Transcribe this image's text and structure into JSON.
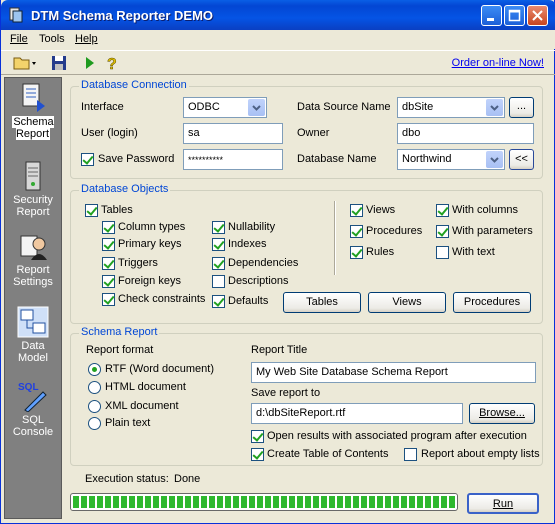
{
  "window": {
    "title": "DTM Schema Reporter DEMO"
  },
  "menu": [
    "File",
    "Tools",
    "Help"
  ],
  "toolbar": {
    "order_link": "Order on-line Now!"
  },
  "sidebar": [
    {
      "label": "Schema Report",
      "icon": "schema-report-icon"
    },
    {
      "label": "Security Report",
      "icon": "server-icon"
    },
    {
      "label": "Report Settings",
      "icon": "settings-icon"
    },
    {
      "label": "Data Model",
      "icon": "data-model-icon"
    },
    {
      "label": "SQL Console",
      "icon": "sql-console-icon"
    }
  ],
  "connection": {
    "title": "Database Connection",
    "interface_label": "Interface",
    "interface_value": "ODBC",
    "user_label": "User (login)",
    "user_value": "sa",
    "save_password_label": "Save Password",
    "save_password_checked": true,
    "password_value": "**********",
    "dsn_label": "Data Source Name",
    "dsn_value": "dbSite",
    "dsn_browse": "...",
    "owner_label": "Owner",
    "owner_value": "dbo",
    "dbname_label": "Database Name",
    "dbname_value": "Northwind",
    "dbname_button": "<<"
  },
  "objects": {
    "title": "Database Objects",
    "tables": {
      "label": "Tables",
      "checked": true
    },
    "col1": [
      {
        "label": "Column types",
        "checked": true
      },
      {
        "label": "Primary keys",
        "checked": true
      },
      {
        "label": "Triggers",
        "checked": true
      },
      {
        "label": "Foreign keys",
        "checked": true
      },
      {
        "label": "Check constraints",
        "checked": true
      }
    ],
    "col2": [
      {
        "label": "Nullability",
        "checked": true
      },
      {
        "label": "Indexes",
        "checked": true
      },
      {
        "label": "Dependencies",
        "checked": true
      },
      {
        "label": "Descriptions",
        "checked": false
      },
      {
        "label": "Defaults",
        "checked": true
      }
    ],
    "col3": [
      {
        "label": "Views",
        "checked": true
      },
      {
        "label": "Procedures",
        "checked": true
      },
      {
        "label": "Rules",
        "checked": true
      }
    ],
    "col4": [
      {
        "label": "With columns",
        "checked": true
      },
      {
        "label": "With parameters",
        "checked": true
      },
      {
        "label": "With text",
        "checked": false
      }
    ],
    "buttons": {
      "tables": "Tables",
      "views": "Views",
      "procedures": "Procedures"
    }
  },
  "schema_report": {
    "title": "Schema Report",
    "format_label": "Report format",
    "formats": [
      {
        "label": "RTF (Word document)",
        "selected": true
      },
      {
        "label": "HTML document",
        "selected": false
      },
      {
        "label": "XML document",
        "selected": false
      },
      {
        "label": "Plain text",
        "selected": false
      }
    ],
    "report_title_label": "Report Title",
    "report_title_value": "My Web Site Database Schema Report",
    "save_label": "Save report to",
    "save_value": "d:\\dbSiteReport.rtf",
    "browse": "Browse...",
    "open_results": {
      "label": "Open results with associated program after execution",
      "checked": true
    },
    "toc": {
      "label": "Create Table of Contents",
      "checked": true
    },
    "empty_lists": {
      "label": "Report about empty lists",
      "checked": false
    }
  },
  "status": {
    "label": "Execution status:",
    "value": "Done",
    "progress": 1.0,
    "run": "Run"
  },
  "colors": {
    "title_blue": "#0a5fe6",
    "group_title": "#0046d5",
    "check_green": "#21a121",
    "progress_green": "#2eb82e"
  }
}
